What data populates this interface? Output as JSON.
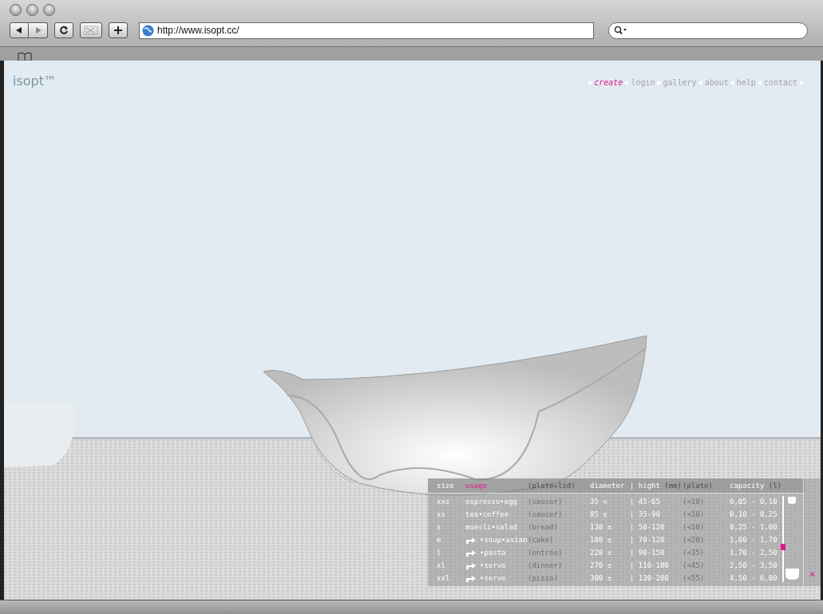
{
  "browser": {
    "url": "http://www.isopt.cc/"
  },
  "site": {
    "logo": "isopt™",
    "nav": [
      {
        "label": "create",
        "selected": true
      },
      {
        "label": "login",
        "selected": false
      },
      {
        "label": "gallery",
        "selected": false
      },
      {
        "label": "about",
        "selected": false
      },
      {
        "label": "help",
        "selected": false
      },
      {
        "label": "contact",
        "selected": false
      }
    ]
  },
  "size_table": {
    "columns": [
      {
        "label": "size",
        "selected": false
      },
      {
        "label": "usage",
        "selected": true
      },
      {
        "label": "(plate=lid)",
        "selected": false
      },
      {
        "label": "diameter",
        "selected": false
      },
      {
        "label": "| hight",
        "unit": "(mm)",
        "selected": false
      },
      {
        "label": "(plate)",
        "selected": false
      },
      {
        "label": "capacity",
        "unit": "(l)",
        "selected": false
      }
    ],
    "rows": [
      {
        "size": "xxs",
        "icon": false,
        "usage": "espresso•egg",
        "plate": "(saucer)",
        "diameter": "35 <",
        "hight": "| 45-65",
        "plate_hight": "(<10)",
        "capacity": "0,05 - 0,10"
      },
      {
        "size": "xs",
        "icon": false,
        "usage": "tea•coffee",
        "plate": "(saucer)",
        "diameter": "85 ±",
        "hight": "| 35-90",
        "plate_hight": "(<10)",
        "capacity": "0,10 - 0,25"
      },
      {
        "size": "s",
        "icon": false,
        "usage": "muesli•salad",
        "plate": "(bread)",
        "diameter": "130 ±",
        "hight": "| 50-120",
        "plate_hight": "(<10)",
        "capacity": "0,25 - 1,00"
      },
      {
        "size": "m",
        "icon": true,
        "usage": "•soup•asian",
        "plate": "(cake)",
        "diameter": "180 ±",
        "hight": "| 70-120",
        "plate_hight": "(<20)",
        "capacity": "1,00 - 1,70"
      },
      {
        "size": "l",
        "icon": true,
        "usage": "•pasta",
        "plate": "(entrée)",
        "diameter": "220 ±",
        "hight": "| 90-150",
        "plate_hight": "(<35)",
        "capacity": "1,70 - 2,50"
      },
      {
        "size": "xl",
        "icon": true,
        "usage": "•serve",
        "plate": "(dinner)",
        "diameter": "270 ±",
        "hight": "| 110-180",
        "plate_hight": "(<45)",
        "capacity": "2,50 - 3,50"
      },
      {
        "size": "xxl",
        "icon": true,
        "usage": "•serve",
        "plate": "(pizza)",
        "diameter": "300 ±",
        "hight": "| 130-200",
        "plate_hight": "(<55)",
        "capacity": "4,50 - 6,00"
      }
    ],
    "size_slider": {
      "level": 0.4
    },
    "close": "×"
  }
}
